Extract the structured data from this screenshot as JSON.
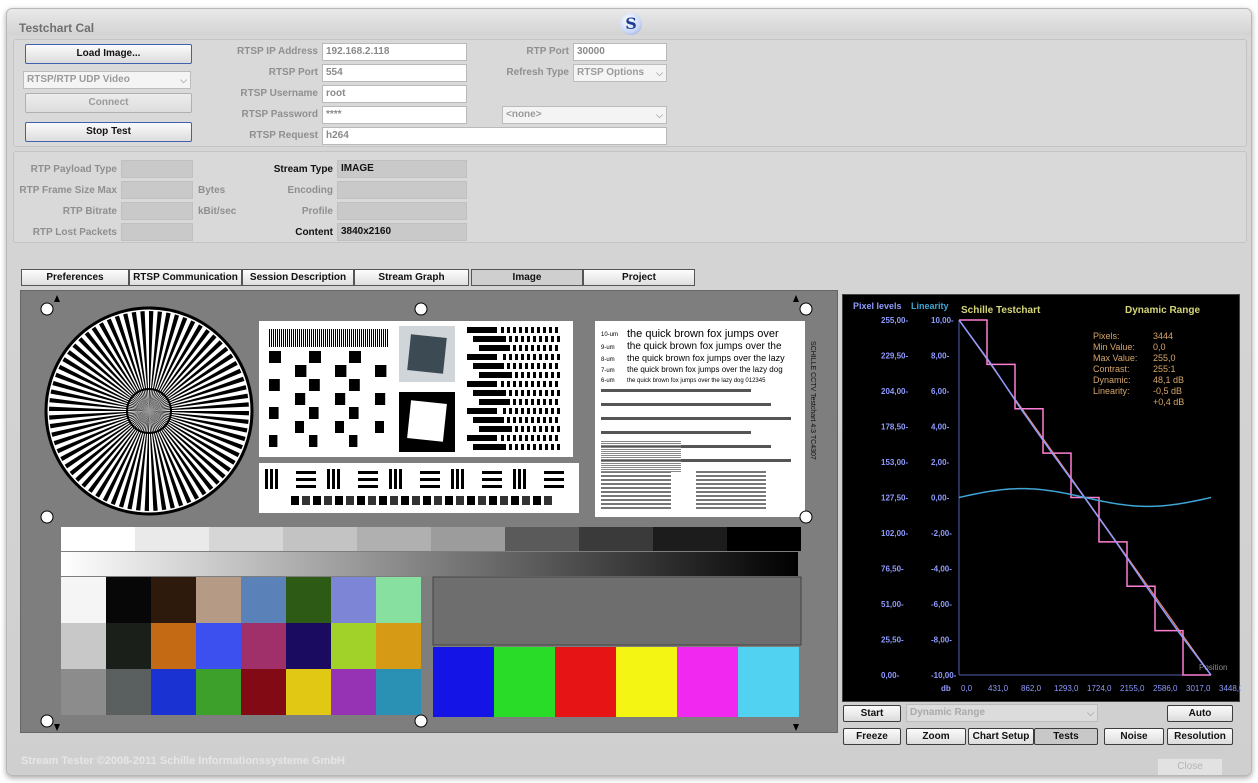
{
  "window": {
    "title": "Testchart Cal",
    "logo": "S",
    "footer": "Stream Tester ©2008-2011 Schille Informationssysteme GmbH",
    "close_label": "Close"
  },
  "connection": {
    "load_image": "Load Image...",
    "protocol": "RTSP/RTP UDP Video",
    "connect": "Connect",
    "stop_test": "Stop Test",
    "ip_label": "RTSP IP Address",
    "ip_value": "192.168.2.118",
    "port_label": "RTSP Port",
    "port_value": "554",
    "user_label": "RTSP Username",
    "user_value": "root",
    "password_label": "RTSP Password",
    "password_value": "****",
    "request_label": "RTSP Request",
    "request_value": "h264",
    "rtp_port_label": "RTP Port",
    "rtp_port_value": "30000",
    "refresh_label": "Refresh Type",
    "refresh_value": "RTSP Options",
    "none_select": "<none>"
  },
  "stats": {
    "payload_label": "RTP Payload Type",
    "frame_label": "RTP Frame Size Max",
    "frame_unit": "Bytes",
    "bitrate_label": "RTP Bitrate",
    "bitrate_unit": "kBit/sec",
    "lost_label": "RTP Lost Packets",
    "stream_type_label": "Stream Type",
    "stream_type_value": "IMAGE",
    "encoding_label": "Encoding",
    "profile_label": "Profile",
    "content_label": "Content",
    "content_value": "3840x2160"
  },
  "tabs": [
    "Preferences",
    "RTSP Communication",
    "Session Description",
    "Stream Graph",
    "Image",
    "Project"
  ],
  "testchart": {
    "side_text": "SCHILLE CCTV Testchart 4:3 TC4307",
    "text_lines": [
      "the quick brown fox jumps over",
      "the quick brown fox jumps over the",
      "the quick brown fox jumps over the lazy",
      "the quick brown fox jumps over the lazy dog",
      "the quick brown fox jumps over the lazy dog 012345"
    ],
    "line_sizes": [
      "10-um",
      "9-um",
      "8-um",
      "7-um",
      "6-um"
    ]
  },
  "graph": {
    "left_axis_title": "Pixel levels",
    "right_axis_title": "Linearity",
    "chart_title": "Schille Testchart",
    "chart_subtitle": "Dynamic Range",
    "position_label": "Position",
    "db_label": "db",
    "pixel_ticks": [
      "255,00-",
      "229,50-",
      "204,00-",
      "178,50-",
      "153,00-",
      "127,50-",
      "102,00-",
      "76,50-",
      "51,00-",
      "25,50-",
      "0,00-"
    ],
    "linearity_ticks": [
      "10,00-",
      "8,00-",
      "6,00-",
      "4,00-",
      "2,00-",
      "0,00-",
      "-2,00-",
      "-4,00-",
      "-6,00-",
      "-8,00-",
      "-10,00-"
    ],
    "x_ticks": [
      "0,0",
      "431,0",
      "862,0",
      "1293,0",
      "1724,0",
      "2155,0",
      "2586,0",
      "3017,0",
      "3448,0"
    ],
    "info_labels": [
      "Pixels:",
      "Min Value:",
      "Max Value:",
      "Contrast:",
      "Dynamic:",
      "Linearity:",
      ""
    ],
    "info_values": [
      "3444",
      "0,0",
      "255,0",
      "255:1",
      "48,1 dB",
      "-0,5 dB",
      "+0,4 dB"
    ],
    "colors": {
      "pixel": "#8f9bff",
      "linearity": "#3fa7d6",
      "steps": "#ff7fd4",
      "fit": "#ff8c5a",
      "title": "#d6d67a"
    }
  },
  "chart_data": {
    "type": "line",
    "title": "Schille Testchart",
    "subtitle": "Dynamic Range",
    "xlabel": "Position",
    "ylabel": "Pixel levels",
    "y2label": "Linearity",
    "xlim": [
      0,
      3448
    ],
    "ylim": [
      0,
      255
    ],
    "y2lim": [
      -10,
      10
    ],
    "series": [
      {
        "name": "Pixel levels",
        "x": [
          0,
          431,
          862,
          1293,
          1724,
          2155,
          2586,
          3017,
          3448
        ],
        "values": [
          255,
          224,
          190,
          158,
          127,
          95,
          62,
          30,
          0
        ]
      },
      {
        "name": "Linearity",
        "x": [
          0,
          431,
          862,
          1293,
          1724,
          2155,
          2586,
          3017,
          3448
        ],
        "values": [
          0,
          0.3,
          0.5,
          0.3,
          0,
          -0.3,
          -0.5,
          -0.3,
          0.2
        ]
      }
    ]
  },
  "controls": {
    "start": "Start",
    "mode": "Dynamic Range",
    "auto": "Auto",
    "buttons": [
      "Freeze",
      "Zoom",
      "Chart Setup",
      "Tests",
      "Noise",
      "Resolution"
    ]
  }
}
